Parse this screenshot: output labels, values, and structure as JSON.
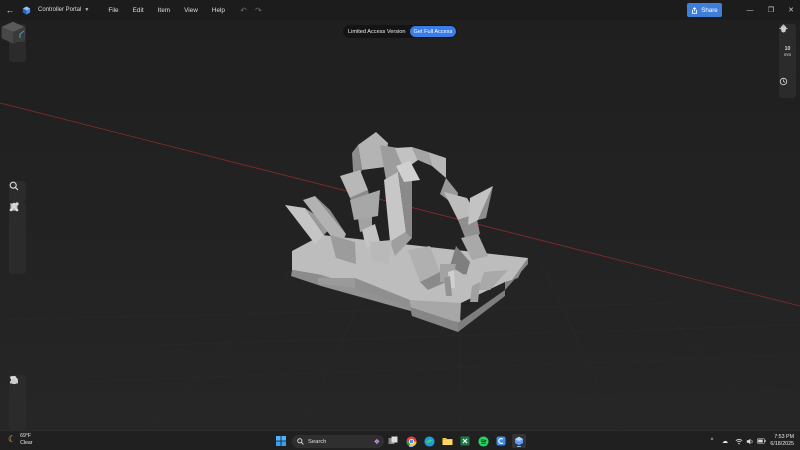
{
  "titlebar": {
    "project_name": "Controller Portal",
    "menu": [
      "File",
      "Edit",
      "Item",
      "View",
      "Help"
    ],
    "share_label": "Share"
  },
  "banner": {
    "text": "Limited Access Version",
    "cta": "Get Full Access"
  },
  "right_toolbar": {
    "grid_value": "10",
    "grid_unit": "mm"
  },
  "taskbar": {
    "weather_temp": "69°F",
    "weather_desc": "Clear",
    "search_placeholder": "Search",
    "time": "7:53 PM",
    "date": "6/18/2025"
  },
  "colors": {
    "accent": "#3f7fd9",
    "titlebar_bg": "#1c1c1c",
    "viewport_bg": "#1f1f1f",
    "model": "#a9a9a9"
  },
  "icons": {
    "left_top": [
      "cube-icon",
      "layers-icon"
    ],
    "left_tools": [
      "zoom-icon",
      "curve-icon",
      "box-icon",
      "nodes-icon",
      "tools-icon"
    ],
    "left_bottom": [
      "support-icon",
      "material-icon",
      "slice-icon"
    ],
    "right": [
      "bucket-icon",
      "grid-size-icon",
      "snap-icon",
      "history-icon"
    ]
  }
}
